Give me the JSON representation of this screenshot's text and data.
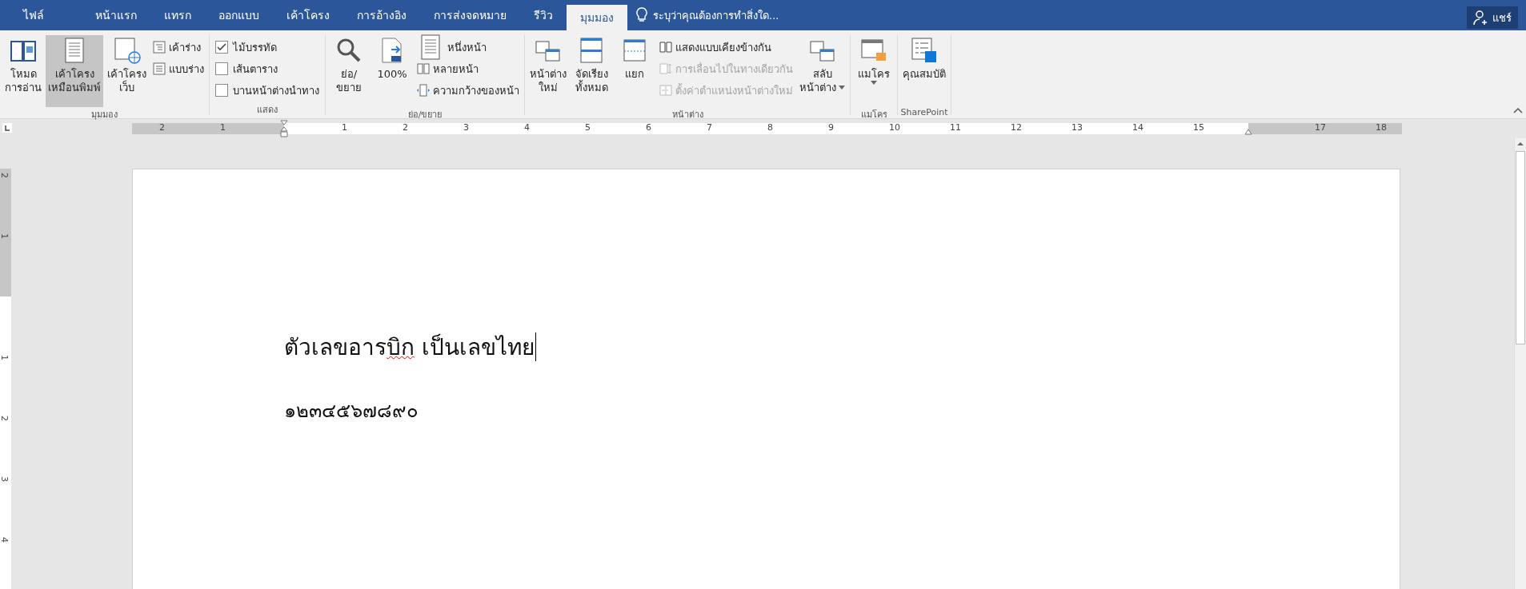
{
  "tabs": [
    {
      "label": "ไฟล์",
      "selected": false
    },
    {
      "label": "หน้าแรก",
      "selected": false
    },
    {
      "label": "แทรก",
      "selected": false
    },
    {
      "label": "ออกแบบ",
      "selected": false
    },
    {
      "label": "เค้าโครง",
      "selected": false
    },
    {
      "label": "การอ้างอิง",
      "selected": false
    },
    {
      "label": "การส่งจดหมาย",
      "selected": false
    },
    {
      "label": "รีวิว",
      "selected": false
    },
    {
      "label": "มุมมอง",
      "selected": true
    }
  ],
  "tell_me": {
    "placeholder": "ระบุว่าคุณต้องการทำสิ่งใด..."
  },
  "share_button": "แชร์",
  "ribbon_groups": [
    {
      "label": "มุมมอง",
      "items": [
        {
          "kind": "large",
          "lines": [
            "โหมด",
            "การอ่าน"
          ],
          "selected": false,
          "dropdown": false
        },
        {
          "kind": "large",
          "lines": [
            "เค้าโครง",
            "เหมือนพิมพ์"
          ],
          "selected": true,
          "dropdown": false
        },
        {
          "kind": "large",
          "lines": [
            "เค้าโครง",
            "เว็บ"
          ],
          "selected": false,
          "dropdown": false
        },
        {
          "kind": "stack",
          "items": [
            {
              "label": "เค้าร่าง",
              "disabled": false
            },
            {
              "label": "แบบร่าง",
              "disabled": false
            }
          ]
        }
      ]
    },
    {
      "label": "แสดง",
      "items": [
        {
          "kind": "checks",
          "items": [
            {
              "label": "ไม้บรรทัด",
              "checked": true
            },
            {
              "label": "เส้นตาราง",
              "checked": false
            },
            {
              "label": "บานหน้าต่างนำทาง",
              "checked": false
            }
          ]
        }
      ]
    },
    {
      "label": "ย่อ/ขยาย",
      "items": [
        {
          "kind": "large",
          "lines": [
            "ย่อ/",
            "ขยาย"
          ],
          "selected": false,
          "dropdown": false
        },
        {
          "kind": "large",
          "lines": [
            "100%"
          ],
          "selected": false,
          "dropdown": false
        },
        {
          "kind": "stack",
          "items": [
            {
              "label": "หนึ่งหน้า",
              "disabled": false
            },
            {
              "label": "หลายหน้า",
              "disabled": false
            },
            {
              "label": "ความกว้างของหน้า",
              "disabled": false
            }
          ]
        }
      ]
    },
    {
      "label": "หน้าต่าง",
      "items": [
        {
          "kind": "large",
          "lines": [
            "หน้าต่าง",
            "ใหม่"
          ],
          "selected": false,
          "dropdown": false
        },
        {
          "kind": "large",
          "lines": [
            "จัดเรียง",
            "ทั้งหมด"
          ],
          "selected": false,
          "dropdown": false
        },
        {
          "kind": "large",
          "lines": [
            "แยก"
          ],
          "selected": false,
          "dropdown": false
        },
        {
          "kind": "stack",
          "items": [
            {
              "label": "แสดงแบบเคียงข้างกัน",
              "disabled": false
            },
            {
              "label": "การเลื่อนไปในทางเดียวกัน",
              "disabled": true
            },
            {
              "label": "ตั้งค่าตำแหน่งหน้าต่างใหม่",
              "disabled": true
            }
          ]
        },
        {
          "kind": "large",
          "lines": [
            "สลับ",
            "หน้าต่าง"
          ],
          "selected": false,
          "dropdown": true
        }
      ]
    },
    {
      "label": "แมโคร",
      "items": [
        {
          "kind": "large",
          "lines": [
            "แมโคร"
          ],
          "selected": false,
          "dropdown": true
        }
      ]
    },
    {
      "label": "SharePoint",
      "items": [
        {
          "kind": "large",
          "lines": [
            "คุณสมบัติ"
          ],
          "selected": false,
          "dropdown": false
        }
      ]
    }
  ],
  "ruler": {
    "labels": [
      "2",
      "1",
      "1",
      "2",
      "3",
      "4",
      "5",
      "6",
      "7",
      "8",
      "9",
      "10",
      "11",
      "12",
      "13",
      "14",
      "15",
      "17",
      "18"
    ]
  },
  "vertical_ruler": {
    "labels": [
      "2",
      "1",
      "1",
      "2",
      "3",
      "4"
    ]
  },
  "document": {
    "paragraphs": [
      {
        "runs": [
          {
            "text": "ตัวเลขอาร",
            "misspelled": false
          },
          {
            "text": "บิก",
            "misspelled": true
          },
          {
            "text": " เป็นเลขไทย",
            "misspelled": false
          }
        ],
        "cursor": true
      },
      {
        "runs": [
          {
            "text": "๑๒๓๔๕๖๗๘๙๐",
            "misspelled": false
          }
        ],
        "cursor": false
      }
    ]
  }
}
